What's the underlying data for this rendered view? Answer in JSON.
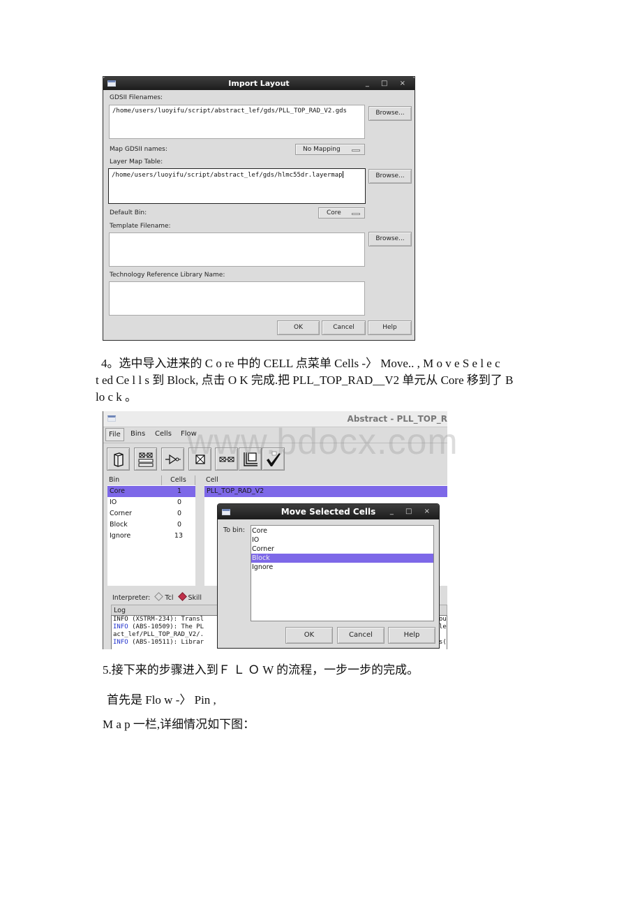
{
  "import_layout": {
    "title": "Import Layout",
    "window_controls": "_ □ ×",
    "gdsii_filenames_label": "GDSII Filenames:",
    "gdsii_filename_value": "/home/users/luoyifu/script/abstract_lef/gds/PLL_TOP_RAD_V2.gds",
    "map_gdsii_names_label": "Map GDSII names:",
    "map_gdsii_names_value": "No Mapping",
    "layer_map_table_label": "Layer Map Table:",
    "layer_map_table_value": "/home/users/luoyifu/script/abstract_lef/gds/hlmc55dr.layermap",
    "default_bin_label": "Default Bin:",
    "default_bin_value": "Core",
    "template_filename_label": "Template Filename:",
    "template_filename_value": "",
    "tech_ref_lib_label": "Technology Reference Library Name:",
    "tech_ref_lib_value": "",
    "browse_label": "Browse...",
    "ok_label": "OK",
    "cancel_label": "Cancel",
    "help_label": "Help"
  },
  "paragraphs": {
    "step4_line1": "4。选中导入进来的 C o re 中的 CELL 点菜单 Cells -〉 Move..    , M o v e  S e  l   e c",
    "step4_line2": "t ed Ce  l   l s 到 Block, 点击 O K     完成.把 PLL_TOP_RAD__V2 单元从 Core 移到了 B",
    "step4_line3": "lo c  k 。",
    "step5": "5.接下来的步骤进入到Ｆ Ｌ Ｏ W 的流程，一步一步的完成。",
    "flow_pin": "首先是 Flo w     -〉  Pin ,",
    "map_line": "M a  p  一栏,详细情况如下图："
  },
  "abstract_window": {
    "title": "Abstract - PLL_TOP_R",
    "menus": [
      "File",
      "Bins",
      "Cells",
      "Flow"
    ],
    "toolbar_icons": [
      "library-icon",
      "bin-cells-icon",
      "buffer-icon",
      "cell-box-icon",
      "cell-pair-icon",
      "layout-icon",
      "verify-checkmark-icon"
    ],
    "bins_table": {
      "headers": [
        "Bin",
        "Cells"
      ],
      "rows": [
        {
          "bin": "Core",
          "cells": "1",
          "selected": true
        },
        {
          "bin": "IO",
          "cells": "0",
          "selected": false
        },
        {
          "bin": "Corner",
          "cells": "0",
          "selected": false
        },
        {
          "bin": "Block",
          "cells": "0",
          "selected": false
        },
        {
          "bin": "Ignore",
          "cells": "13",
          "selected": false
        }
      ]
    },
    "cells_table": {
      "header": "Cell",
      "rows": [
        "PLL_TOP_RAD_V2"
      ]
    },
    "interpreter_label": "Interpreter:",
    "interpreter_options": [
      "Tcl",
      "Skill"
    ],
    "interpreter_selected": "Skill",
    "log_header": "Log",
    "log_lines": [
      {
        "tag": "INFO",
        "text": " (XSTRM-234): Transl",
        "blue": false
      },
      {
        "tag": "INFO",
        "text": " (ABS-10509): The PL",
        "blue": true
      },
      {
        "tag": "",
        "text": "act_lef/PLL_TOP_RAD_V2/.",
        "blue": false
      },
      {
        "tag": "INFO",
        "text": " (ABS-10511): Librar",
        "blue": true
      }
    ],
    "log_right_fragments": [
      "ou",
      "le",
      "s("
    ]
  },
  "move_selected_cells": {
    "title": "Move Selected Cells",
    "window_controls": "_ □ ×",
    "to_bin_label": "To bin:",
    "bins": [
      {
        "label": "Core",
        "selected": false
      },
      {
        "label": "IO",
        "selected": false
      },
      {
        "label": "Corner",
        "selected": false
      },
      {
        "label": "Block",
        "selected": true
      },
      {
        "label": "Ignore",
        "selected": false
      }
    ],
    "ok_label": "OK",
    "cancel_label": "Cancel",
    "help_label": "Help"
  },
  "watermark": "www.bdocx.com",
  "colors": {
    "selection": "#7d68e8",
    "dialog_bg": "#dcdcdc",
    "titlebar": "#222222",
    "radio_selected": "#c0304a",
    "log_info_blue": "#2233cc"
  }
}
